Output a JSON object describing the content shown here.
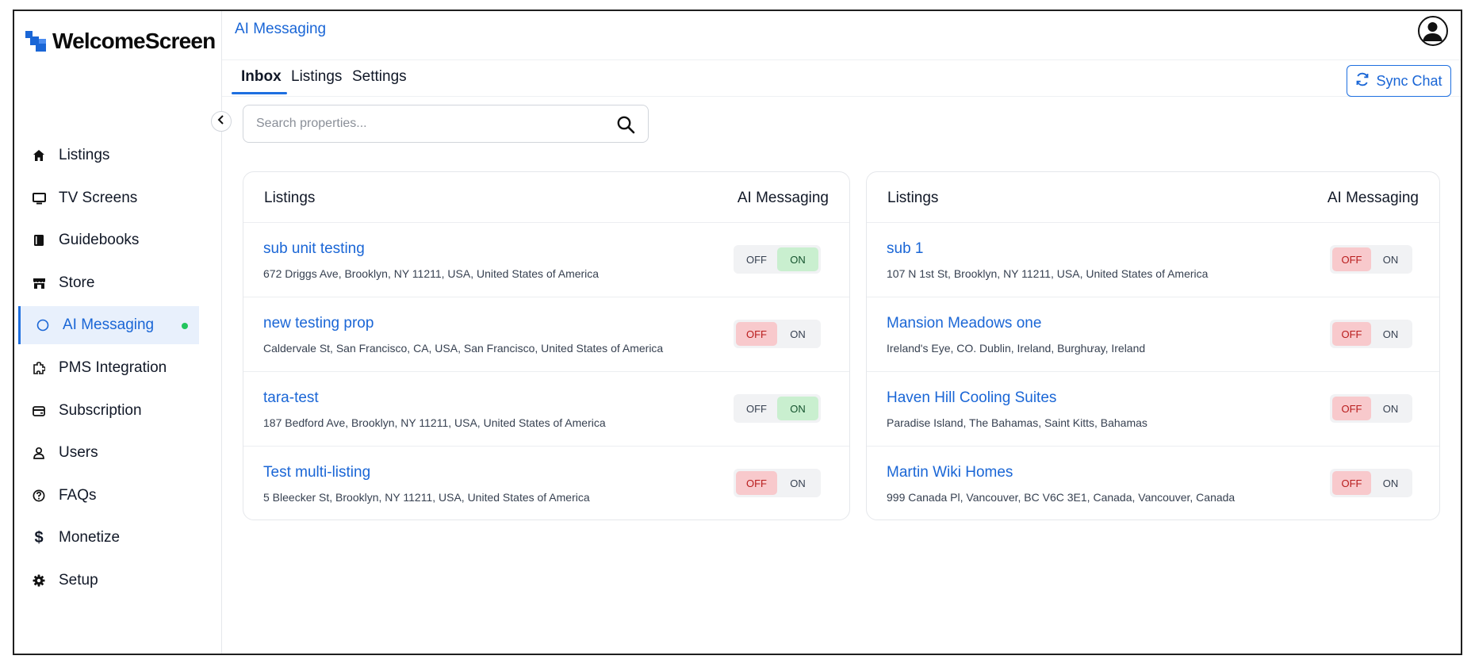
{
  "app": {
    "brand": "WelcomeScreen",
    "page_title": "AI Messaging",
    "brand_color": "#1a66d6"
  },
  "sidebar": {
    "items": [
      {
        "label": "Listings",
        "icon": "home-icon"
      },
      {
        "label": "TV Screens",
        "icon": "monitor-icon"
      },
      {
        "label": "Guidebooks",
        "icon": "book-icon"
      },
      {
        "label": "Store",
        "icon": "store-icon"
      },
      {
        "label": "AI Messaging",
        "icon": "chat-circle-icon",
        "active": true,
        "status_dot": "#22c55e"
      },
      {
        "label": "PMS Integration",
        "icon": "puzzle-icon"
      },
      {
        "label": "Subscription",
        "icon": "wallet-icon"
      },
      {
        "label": "Users",
        "icon": "user-icon"
      },
      {
        "label": "FAQs",
        "icon": "question-icon"
      },
      {
        "label": "Monetize",
        "icon": "dollar-icon"
      },
      {
        "label": "Setup",
        "icon": "gear-icon"
      }
    ]
  },
  "tabs": [
    {
      "label": "Inbox",
      "active": true
    },
    {
      "label": "Listings",
      "active": false
    },
    {
      "label": "Settings",
      "active": false
    }
  ],
  "sync_button": {
    "label": "Sync Chat",
    "icon": "refresh-icon"
  },
  "search": {
    "placeholder": "Search properties...",
    "value": ""
  },
  "panels": {
    "left": {
      "header_left": "Listings",
      "header_right": "AI Messaging",
      "rows": [
        {
          "name": "sub unit testing",
          "address": "672 Driggs Ave, Brooklyn, NY 11211, USA, United States of America",
          "state": "ON"
        },
        {
          "name": "new testing prop",
          "address": "Caldervale St, San Francisco, CA, USA, San Francisco, United States of America",
          "state": "OFF"
        },
        {
          "name": "tara-test",
          "address": "187 Bedford Ave, Brooklyn, NY 11211, USA, United States of America",
          "state": "ON"
        },
        {
          "name": "Test multi-listing",
          "address": "5 Bleecker St, Brooklyn, NY 11211, USA, United States of America",
          "state": "OFF"
        }
      ]
    },
    "right": {
      "header_left": "Listings",
      "header_right": "AI Messaging",
      "rows": [
        {
          "name": "sub 1",
          "address": "107 N 1st St, Brooklyn, NY 11211, USA, United States of America",
          "state": "OFF"
        },
        {
          "name": "Mansion Meadows one",
          "address": "Ireland's Eye, CO. Dublin, Ireland, Burghưay, Ireland",
          "state": "OFF"
        },
        {
          "name": "Haven Hill Cooling Suites",
          "address": "Paradise Island, The Bahamas, Saint Kitts, Bahamas",
          "state": "OFF"
        },
        {
          "name": "Martin Wiki Homes",
          "address": "999 Canada Pl, Vancouver, BC V6C 3E1, Canada, Vancouver, Canada",
          "state": "OFF"
        }
      ]
    }
  },
  "toggle_labels": {
    "off": "OFF",
    "on": "ON"
  },
  "colors": {
    "on_bg": "#c9efcf",
    "off_bg": "#f8c9cc",
    "link": "#1a66d6"
  }
}
